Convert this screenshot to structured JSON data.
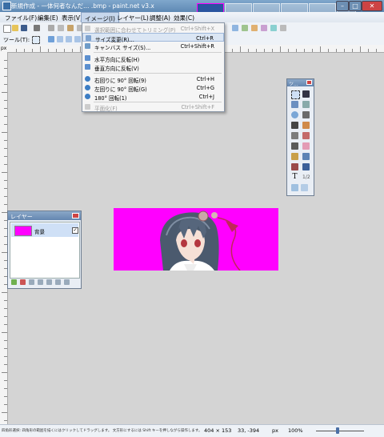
{
  "window": {
    "title": "新規作成 - 一体何者なんだ… .bmp - paint.net v3.x"
  },
  "menubar": {
    "items": [
      "ファイル(F)",
      "編集(E)",
      "表示(V)",
      "イメージ(I)",
      "レイヤー(L)",
      "調整(A)",
      "効果(C)"
    ]
  },
  "toolbar": {
    "tool_label": "ツール(T):"
  },
  "ruler": {
    "unit": "px"
  },
  "image_menu": {
    "items": [
      {
        "label": "選択範囲に合わせてトリミング(P)",
        "shortcut": "Ctrl+Shift+X",
        "disabled": true
      },
      {
        "label": "サイズ変更(R)...",
        "shortcut": "Ctrl+R",
        "disabled": false
      },
      {
        "label": "キャンバス サイズ(S)...",
        "shortcut": "Ctrl+Shift+R",
        "disabled": false
      },
      {
        "label": "水平方向に反転(H)",
        "shortcut": "",
        "disabled": false
      },
      {
        "label": "垂直方向に反転(V)",
        "shortcut": "",
        "disabled": false
      },
      {
        "label": "右回りに 90° 回転(9)",
        "shortcut": "Ctrl+H",
        "disabled": false
      },
      {
        "label": "左回りに 90° 回転(G)",
        "shortcut": "Ctrl+G",
        "disabled": false
      },
      {
        "label": "180° 回転(1)",
        "shortcut": "Ctrl+J",
        "disabled": false
      },
      {
        "label": "平面化(F)",
        "shortcut": "Ctrl+Shift+F",
        "disabled": true
      }
    ]
  },
  "tools_window": {
    "title": "ツ..."
  },
  "layers_window": {
    "title": "レイヤー",
    "layers": [
      {
        "name": "背景",
        "visible": true
      }
    ]
  },
  "status": {
    "hint": "四角形選択: 四角形の範囲を描くにはクリックしてドラッグします。 文方形にするには Shift キーを押しながら操作します。",
    "size": "404 × 153",
    "position": "33, -394",
    "unit": "px",
    "zoom": "100%"
  },
  "colors": {
    "accent": "#ff00ff",
    "title": "#6b92bb",
    "menu_highlight": "#dbe6f4"
  }
}
